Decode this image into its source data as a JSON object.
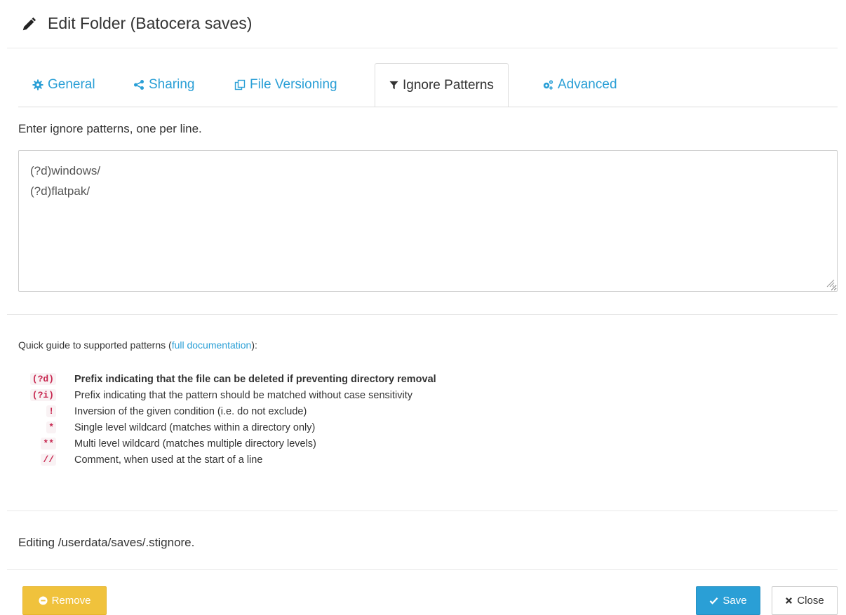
{
  "header": {
    "title": "Edit Folder (Batocera saves)",
    "icon": "pencil-icon"
  },
  "tabs": [
    {
      "label": "General",
      "icon": "gear-icon",
      "active": false
    },
    {
      "label": "Sharing",
      "icon": "share-icon",
      "active": false
    },
    {
      "label": "File Versioning",
      "icon": "copy-icon",
      "active": false
    },
    {
      "label": "Ignore Patterns",
      "icon": "filter-icon",
      "active": true
    },
    {
      "label": "Advanced",
      "icon": "gears-icon",
      "active": false
    }
  ],
  "instructions": "Enter ignore patterns, one per line.",
  "patterns_value": "(?d)windows/\n(?d)flatpak/",
  "guide": {
    "prefix": "Quick guide to supported patterns (",
    "link": "full documentation",
    "suffix": "):"
  },
  "pattern_help": [
    {
      "code": "(?d)",
      "desc": "Prefix indicating that the file can be deleted if preventing directory removal",
      "bold": true
    },
    {
      "code": "(?i)",
      "desc": "Prefix indicating that the pattern should be matched without case sensitivity",
      "bold": false
    },
    {
      "code": "!",
      "desc": "Inversion of the given condition (i.e. do not exclude)",
      "bold": false
    },
    {
      "code": "*",
      "desc": "Single level wildcard (matches within a directory only)",
      "bold": false
    },
    {
      "code": "**",
      "desc": "Multi level wildcard (matches multiple directory levels)",
      "bold": false
    },
    {
      "code": "//",
      "desc": "Comment, when used at the start of a line",
      "bold": false
    }
  ],
  "editing_note": "Editing /userdata/saves/.stignore.",
  "buttons": {
    "remove": "Remove",
    "save": "Save",
    "close": "Close"
  },
  "colors": {
    "accent": "#2a9fd6",
    "warning": "#f0c23c",
    "code": "#c7254e"
  }
}
